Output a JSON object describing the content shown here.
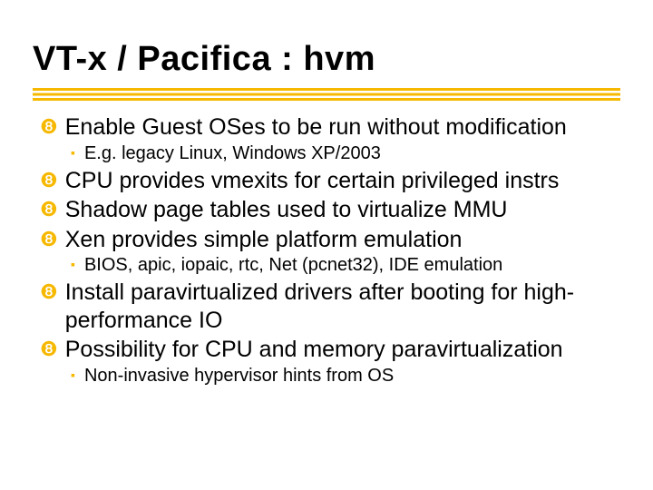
{
  "title": "VT-x / Pacifica : hvm",
  "bullets": [
    {
      "level": 1,
      "text": "Enable Guest OSes to be run without modification",
      "sub": [
        {
          "text": "E.g. legacy Linux, Windows XP/2003"
        }
      ]
    },
    {
      "level": 1,
      "text": "CPU provides vmexits for certain privileged instrs",
      "sub": []
    },
    {
      "level": 1,
      "text": "Shadow page tables used to virtualize MMU",
      "sub": []
    },
    {
      "level": 1,
      "text": "Xen provides simple platform emulation",
      "sub": [
        {
          "text": "BIOS, apic, iopaic, rtc, Net (pcnet32), IDE emulation"
        }
      ]
    },
    {
      "level": 1,
      "text": "Install paravirtualized drivers after booting for high-performance IO",
      "sub": []
    },
    {
      "level": 1,
      "text": "Possibility for CPU and memory paravirtualization",
      "sub": [
        {
          "text": "Non-invasive hypervisor hints from OS"
        }
      ]
    }
  ],
  "glyphs": {
    "l1": "❽",
    "l2": "▪"
  }
}
